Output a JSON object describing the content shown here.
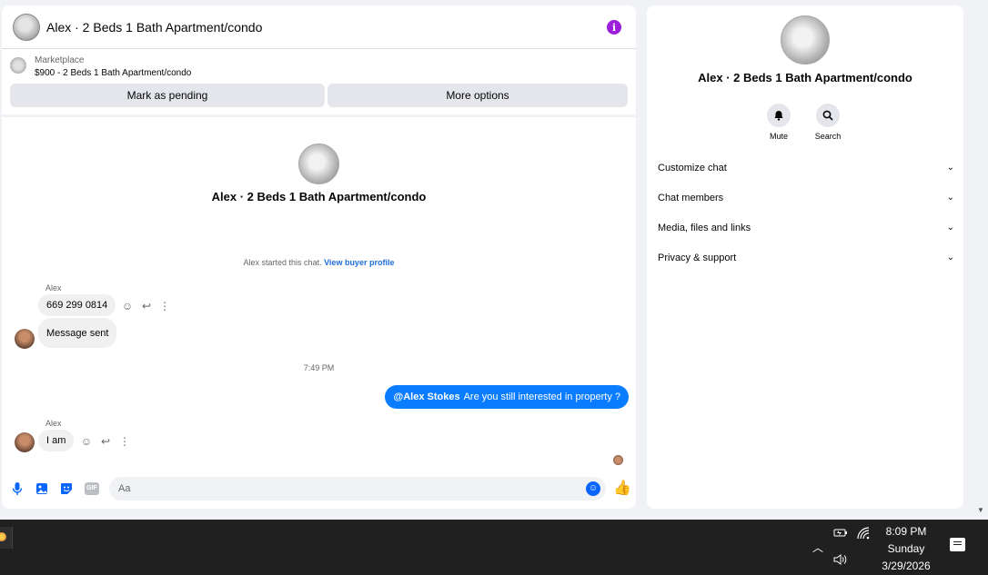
{
  "chat": {
    "title": "Alex · 2 Beds 1 Bath Apartment/condo",
    "info_glyph": "i",
    "marketplace": {
      "label": "Marketplace",
      "listing": "$900 - 2 Beds 1 Bath Apartment/condo"
    },
    "buttons": {
      "pending": "Mark as pending",
      "more": "More options"
    },
    "center_title": "Alex · 2 Beds 1 Bath Apartment/condo",
    "started_text": "Alex started this chat.",
    "started_link": "View buyer profile",
    "messages": [
      {
        "sender": "Alex",
        "text": "669 299 0814"
      },
      {
        "text": "Message sent"
      },
      {
        "timestamp": "7:49 PM"
      },
      {
        "mention": "@Alex Stokes",
        "text": "Are you still interested in property ?"
      },
      {
        "sender": "Alex",
        "text": "I am"
      }
    ],
    "composer": {
      "placeholder": "Aa",
      "gif_label": "GIF"
    }
  },
  "sidebar": {
    "title": "Alex · 2 Beds 1 Bath Apartment/condo",
    "actions": [
      {
        "label": "Mute",
        "icon": "bell-icon"
      },
      {
        "label": "Search",
        "icon": "search-icon"
      }
    ],
    "menu": [
      "Customize chat",
      "Chat members",
      "Media, files and links",
      "Privacy & support"
    ]
  },
  "taskbar": {
    "time": "8:09 PM",
    "day": "Sunday",
    "date": "3/29/2026"
  },
  "colors": {
    "accent": "#0866ff",
    "outgoing_bubble": "#0a7cff",
    "info": "#9b1fdb",
    "link": "#216fdb"
  }
}
